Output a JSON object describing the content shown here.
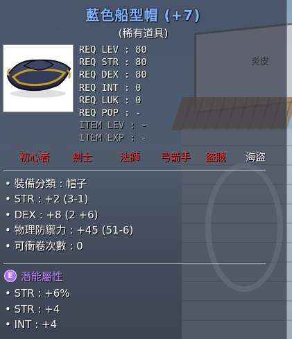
{
  "item": {
    "name": "藍色船型帽 (+7)",
    "rarity": "(稀有道具)"
  },
  "background": {
    "book_label": "炎皮"
  },
  "requirements": [
    {
      "label": "REQ LEV",
      "value": ": 80",
      "dim": false
    },
    {
      "label": "REQ STR",
      "value": ": 80",
      "dim": false
    },
    {
      "label": "REQ DEX",
      "value": ": 80",
      "dim": false
    },
    {
      "label": "REQ INT",
      "value": ": 0",
      "dim": false
    },
    {
      "label": "REQ LUK",
      "value": ": 0",
      "dim": false
    },
    {
      "label": "REQ POP",
      "value": ": -",
      "dim": false
    },
    {
      "label": "ITEM LEV",
      "value": ": -",
      "dim": true
    },
    {
      "label": "ITEM EXP",
      "value": ": -",
      "dim": true
    }
  ],
  "jobs": [
    {
      "label": "初心者",
      "allowed": false
    },
    {
      "label": "劍士",
      "allowed": false
    },
    {
      "label": "法師",
      "allowed": false
    },
    {
      "label": "弓箭手",
      "allowed": false
    },
    {
      "label": "盜賊",
      "allowed": false
    },
    {
      "label": "海盜",
      "allowed": true
    }
  ],
  "stats": [
    "• 裝備分類 : 帽子",
    "• STR : +2 (3-1)",
    "• DEX : +8 (2 +6)",
    "• 物理防禦力 : +45 (51-6)",
    "• 可衝卷次數 : 0"
  ],
  "potential": {
    "badge": "E",
    "title": "潛能屬性",
    "lines": [
      "• STR : +6%",
      "• STR : +4",
      "• INT : +4"
    ]
  },
  "colors": {
    "title": "#7fb2ff",
    "job_disallowed": "#ff3030",
    "job_allowed": "#ffffff",
    "potential": "#c58dff",
    "dim_text": "#a7a7a7"
  }
}
